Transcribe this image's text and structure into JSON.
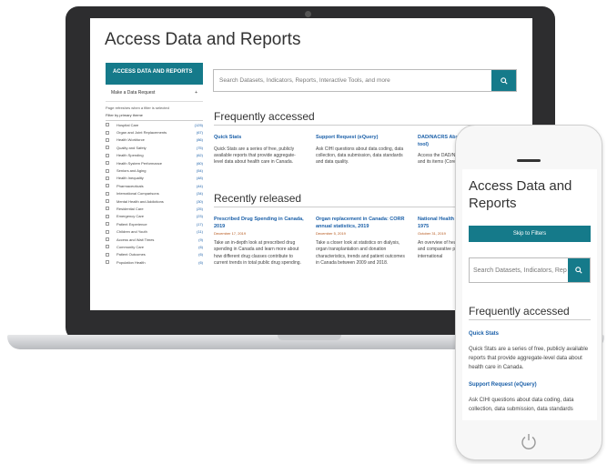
{
  "site": {
    "title": "Access Data and Reports"
  },
  "sidebar": {
    "header": "ACCESS DATA AND REPORTS",
    "request_label": "Make a Data Request",
    "request_icon": "+",
    "note": "Page refreshes when a filter is selected",
    "filter_label": "Filter by primary theme",
    "items": [
      {
        "label": "Hospital Care",
        "count": "(125)"
      },
      {
        "label": "Organ and Joint Replacements",
        "count": "(67)"
      },
      {
        "label": "Health Workforce",
        "count": "(86)"
      },
      {
        "label": "Quality and Safety",
        "count": "(75)"
      },
      {
        "label": "Health Spending",
        "count": "(62)"
      },
      {
        "label": "Health System Performance",
        "count": "(60)"
      },
      {
        "label": "Seniors and Aging",
        "count": "(54)"
      },
      {
        "label": "Health Inequality",
        "count": "(48)"
      },
      {
        "label": "Pharmaceuticals",
        "count": "(44)"
      },
      {
        "label": "International Comparisons",
        "count": "(34)"
      },
      {
        "label": "Mental Health and Addictions",
        "count": "(30)"
      },
      {
        "label": "Residential Care",
        "count": "(25)"
      },
      {
        "label": "Emergency Care",
        "count": "(23)"
      },
      {
        "label": "Patient Experience",
        "count": "(17)"
      },
      {
        "label": "Children and Youth",
        "count": "(11)"
      },
      {
        "label": "Access and Wait Times",
        "count": "(9)"
      },
      {
        "label": "Community Care",
        "count": "(6)"
      },
      {
        "label": "Patient Outcomes",
        "count": "(6)"
      },
      {
        "label": "Population Health",
        "count": "(6)"
      }
    ]
  },
  "search": {
    "placeholder": "Search Datasets, Indicators, Reports, Interactive Tools, and more"
  },
  "frequent": {
    "heading": "Frequently accessed",
    "cards": [
      {
        "title": "Quick Stats",
        "body": "Quick Stats are a series of free, publicly available reports that provide aggregate-level data about health care in Canada."
      },
      {
        "title": "Support Request (eQuery)",
        "body": "Ask CIHI questions about data coding, data collection, data submission, data standards and data quality."
      },
      {
        "title": "DAD/NACRS Abstracting Manual (web tool)",
        "body": "Access the DAD/NACRS abstracting manual and its items (Core Fields)"
      }
    ]
  },
  "recent": {
    "heading": "Recently released",
    "cards": [
      {
        "title": "Prescribed Drug Spending in Canada, 2019",
        "date": "December 17, 2019",
        "body": "Take an in-depth look at prescribed drug spending in Canada and learn more about how different drug classes contribute to current trends in total public drug spending."
      },
      {
        "title": "Organ replacement in Canada: CORR annual statistics, 2019",
        "date": "December 5, 2019",
        "body": "Take a closer look at statistics on dialysis, organ transplantation and donation characteristics, trends and patient outcomes in Canada between 2009 and 2018."
      },
      {
        "title": "National Health Expenditure Trends, 1975",
        "date": "October 31, 2019",
        "body": "An overview of health care spending trends and comparative provincial, territorial and international"
      }
    ]
  },
  "mobile": {
    "title": "Access Data and Reports",
    "skip_label": "Skip to Filters",
    "search_placeholder": "Search Datasets, Indicators, Rep",
    "heading": "Frequently accessed",
    "link1": "Quick Stats",
    "body1": "Quick Stats are a series of free, publicly available reports that provide aggregate-level data about health care in Canada.",
    "link2": "Support Request (eQuery)",
    "body2": "Ask CIHI questions about data coding, data collection, data submission, data standards"
  },
  "icons": [
    "search-icon",
    "plus-icon",
    "power-icon"
  ],
  "colors": {
    "accent": "#157a8a",
    "link": "#1a5fa8",
    "date": "#b5561a"
  }
}
